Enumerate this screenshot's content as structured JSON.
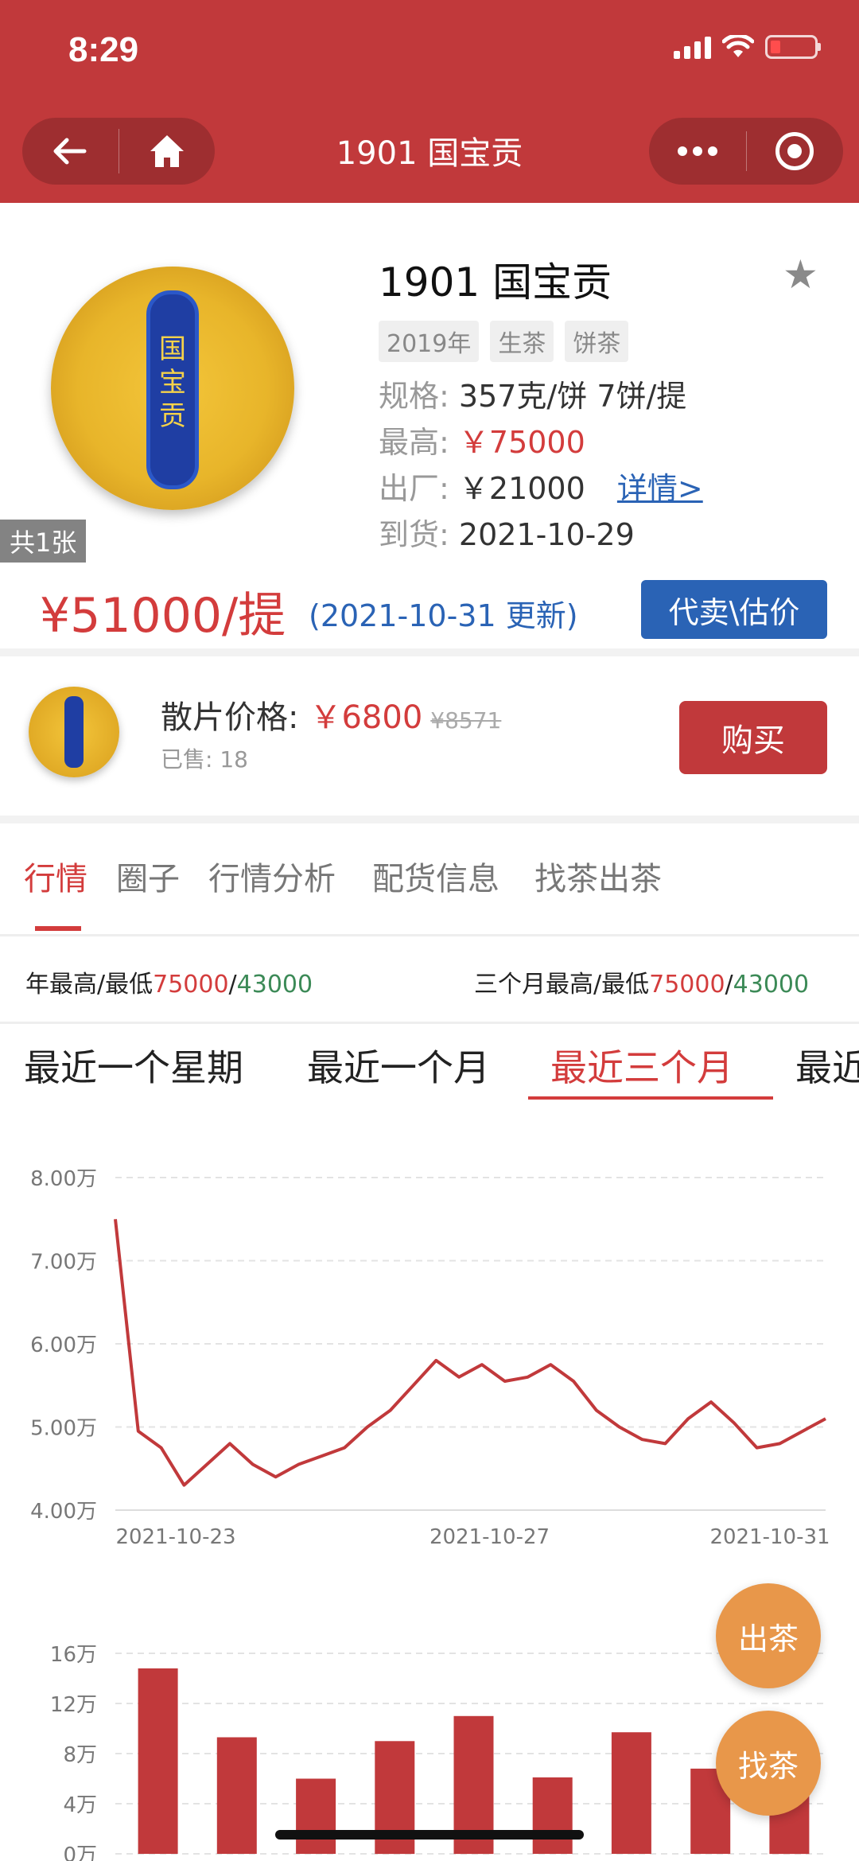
{
  "status": {
    "time": "8:29"
  },
  "nav": {
    "title": "1901 国宝贡",
    "back_icon": "←",
    "home_icon": "⌂"
  },
  "product": {
    "photo_count": "共1张",
    "title": "1901 国宝贡",
    "tags": [
      "2019年",
      "生茶",
      "饼茶"
    ],
    "spec_label": "规格:",
    "spec_value": "357克/饼 7饼/提",
    "high_label": "最高:",
    "high_value": "￥75000",
    "factory_label": "出厂:",
    "factory_value": "￥21000",
    "detail_link": "详情>",
    "arrival_label": "到货:",
    "arrival_value": "2021-10-29",
    "price": "¥51000/提",
    "update_note": "(2021-10-31 更新)",
    "sell_button": "代卖\\估价"
  },
  "loose": {
    "label": "散片价格:",
    "price": "￥6800",
    "original_price": "¥8571",
    "sold": "已售: 18",
    "buy_button": "购买"
  },
  "tabs": [
    "行情",
    "圈子",
    "行情分析",
    "配货信息",
    "找茶出茶"
  ],
  "highlow": {
    "year_label": "年最高/最低",
    "year_high": "75000",
    "year_low": "43000",
    "q_label": "三个月最高/最低",
    "q_high": "75000",
    "q_low": "43000",
    "slash": "/"
  },
  "periods": [
    "最近一个星期",
    "最近一个月",
    "最近三个月",
    "最近"
  ],
  "chart_data": [
    {
      "type": "line",
      "title": "",
      "y_ticks": [
        "4.00万",
        "5.00万",
        "6.00万",
        "7.00万",
        "8.00万"
      ],
      "ylim": [
        40000,
        80000
      ],
      "x_ticks": [
        "2021-10-23",
        "2021-10-27",
        "2021-10-31"
      ],
      "series": [
        {
          "color": "#c1393b",
          "values": [
            75000,
            49500,
            47500,
            43000,
            45500,
            48000,
            45500,
            44000,
            45500,
            46500,
            47500,
            50000,
            52000,
            55000,
            58000,
            56000,
            57500,
            55500,
            56000,
            57500,
            55500,
            52000,
            50000,
            48500,
            48000,
            51000,
            53000,
            50500,
            47500,
            48000,
            49500,
            51000
          ]
        }
      ]
    },
    {
      "type": "bar",
      "title": "",
      "y_ticks": [
        "0万",
        "4万",
        "8万",
        "12万",
        "16万"
      ],
      "ylim": [
        0,
        160000
      ],
      "series": [
        {
          "color": "#c1393b",
          "values": [
            148000,
            93000,
            60000,
            90000,
            110000,
            61000,
            97000,
            68000,
            50000
          ]
        }
      ]
    }
  ],
  "fab": {
    "sell": "出茶",
    "find": "找茶"
  },
  "colors": {
    "brand": "#c1393b",
    "blue": "#2a63b5",
    "red": "#d33c3c",
    "green": "#3c8a57",
    "fab": "#e8974a"
  }
}
